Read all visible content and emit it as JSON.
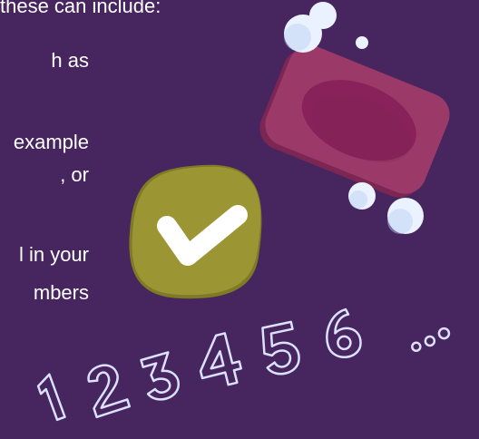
{
  "colors": {
    "background": "#47255f",
    "text": "#ffffff",
    "soap_body": "#9b3a69",
    "soap_dark": "#7c2654",
    "soap_inset": "#89225a",
    "bubble": "#eaf2ff",
    "bubble_shadow": "#b8cdf1",
    "check_badge": "#9b9633",
    "check_badge_dark": "#7e7a26",
    "numbers_stroke": "#dbe1ff"
  },
  "text_fragments": [
    "these can include:",
    "h as",
    "example",
    ", or",
    "l in your",
    "mbers"
  ],
  "numbers_row": [
    "1",
    "2",
    "3",
    "4",
    "5",
    "6",
    "..."
  ],
  "icons": [
    "soap-bar-icon",
    "bubble-icon",
    "checkmark-icon"
  ]
}
